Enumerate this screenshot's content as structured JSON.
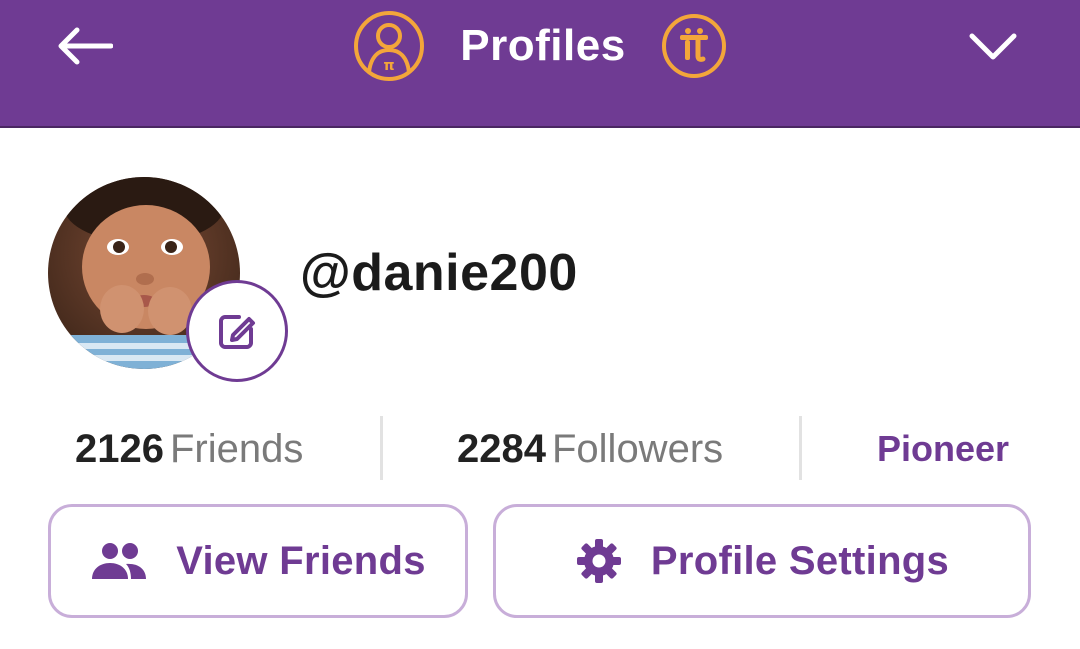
{
  "header": {
    "title": "Profiles",
    "back_icon": "arrow-left-icon",
    "profile_icon": "pi-user-icon",
    "coin_icon": "pi-coin-icon",
    "dropdown_icon": "chevron-down-icon"
  },
  "profile": {
    "username": "@danie200",
    "avatar": "child-photo-avatar",
    "edit_icon": "edit-pencil-icon"
  },
  "stats": {
    "friends_count": "2126",
    "friends_label": "Friends",
    "followers_count": "2284",
    "followers_label": "Followers",
    "role": "Pioneer"
  },
  "actions": {
    "view_friends_label": "View Friends",
    "view_friends_icon": "people-icon",
    "profile_settings_label": "Profile Settings",
    "profile_settings_icon": "gear-icon"
  },
  "colors": {
    "brand_purple": "#6f3b93",
    "accent_orange": "#f3a63a",
    "button_border": "#c8aed9"
  }
}
